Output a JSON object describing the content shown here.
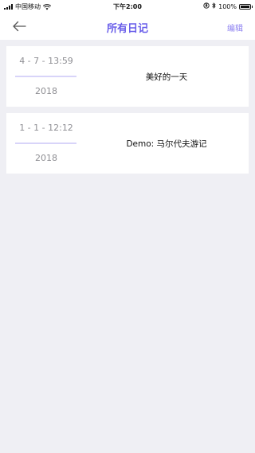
{
  "status_bar": {
    "carrier": "中国移动",
    "time": "下午2:00",
    "battery_percent_label": "100%",
    "battery_level": 1.0
  },
  "nav": {
    "title": "所有日记",
    "edit_label": "编辑"
  },
  "entries": [
    {
      "date": "4 - 7 - 13:59",
      "year": "2018",
      "title": "美好的一天"
    },
    {
      "date": "1 - 1 - 12:12",
      "year": "2018",
      "title": "Demo: 马尔代夫游记"
    }
  ],
  "colors": {
    "accent": "#6a5fea",
    "divider": "#d8d4f9",
    "background": "#efeff4"
  },
  "icons": {
    "back": "arrow-left-icon",
    "wifi": "wifi-icon",
    "lock": "orientation-lock-icon",
    "bluetooth": "bluetooth-icon",
    "battery": "battery-icon",
    "signal": "signal-bars-icon"
  }
}
